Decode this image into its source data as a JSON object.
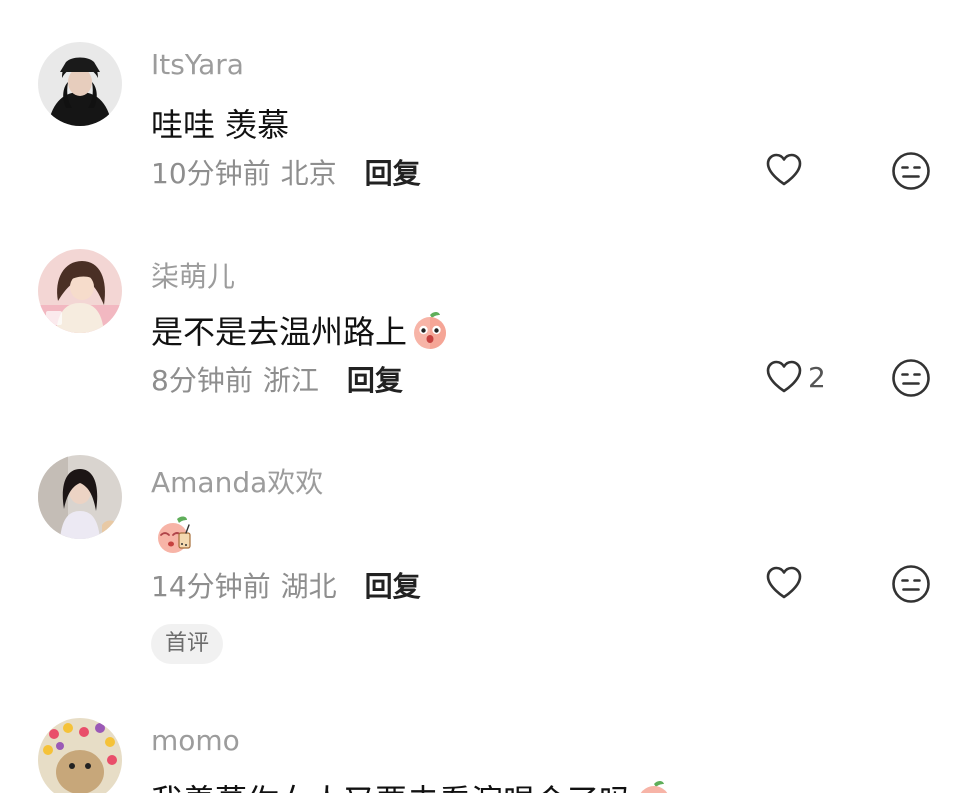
{
  "comments": [
    {
      "username": "ItsYara",
      "text": "哇哇 羡慕",
      "time": "10分钟前",
      "location": "北京",
      "reply_label": "回复",
      "likes": ""
    },
    {
      "username": "柒萌儿",
      "text": "是不是去温州路上",
      "emoji": "peach-surprised-emoji",
      "time": "8分钟前",
      "location": "浙江",
      "reply_label": "回复",
      "likes": "2"
    },
    {
      "username": "Amanda欢欢",
      "text": "",
      "emoji": "peach-drinking-emoji",
      "time": "14分钟前",
      "location": "湖北",
      "reply_label": "回复",
      "likes": "",
      "badge": "首评"
    },
    {
      "username": "momo",
      "text": "我羡慕你女人又要去看演唱会了吗"
    }
  ],
  "colors": {
    "username": "#9c9c9c",
    "text": "#111111",
    "meta": "#8e8e8e",
    "reply": "#222222",
    "badge_bg": "#f1f1f1"
  },
  "icons": {
    "like": "heart-outline-icon",
    "dislike": "unamused-face-icon"
  }
}
